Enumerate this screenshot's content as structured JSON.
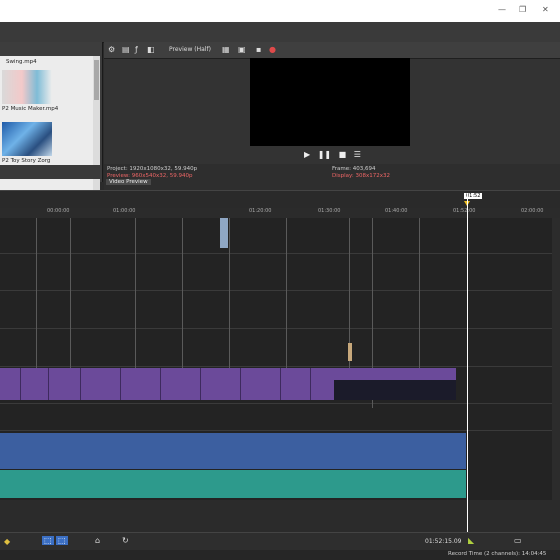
{
  "window": {
    "minimize": "—",
    "restore": "❐",
    "close": "✕"
  },
  "media": {
    "items": [
      {
        "name": "Swing.mp4"
      },
      {
        "name": "P2 Music Maker.mp4"
      },
      {
        "name": "P2 Toy Story Zorg"
      }
    ]
  },
  "preview": {
    "mode_label": "Preview (Half)",
    "project": "Project:  1920x1080x32, 59.940p",
    "preview_res": "Preview:  960x540x32, 59.940p",
    "frame": "Frame:     403,694",
    "display": "Display:   308x172x32",
    "tab_label": "Video Preview"
  },
  "ruler": {
    "ticks": [
      "00:00:00",
      "01:00:00",
      "01:20:00",
      "01:30:00",
      "01:40:00",
      "01:52:00",
      "02:00:00"
    ]
  },
  "playhead_label": "01:52",
  "status": {
    "timecode": "01:52:15.09",
    "record_time": "Record Time (2 channels): 14:04:45"
  },
  "colors": {
    "video_track": "#6b4a9a",
    "audio_track": "#3c5fa0",
    "teal_track": "#2d9a8c"
  }
}
